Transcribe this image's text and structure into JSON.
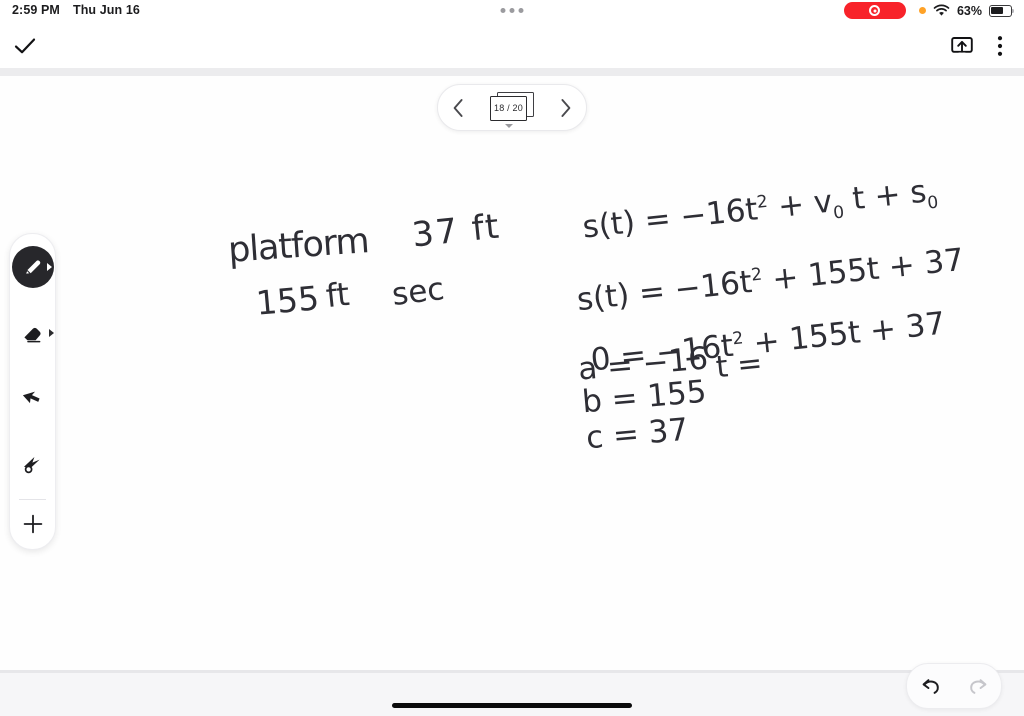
{
  "status_bar": {
    "time": "2:59 PM",
    "date": "Thu Jun 16",
    "battery_percent": "63%",
    "battery_level": 63,
    "recording_indicator": "screen-recording-active",
    "privacy_dot": "microphone-in-use",
    "wifi": "wifi-connected",
    "multitasking_handle": "three-dots"
  },
  "toolbar": {
    "done_label": "done-checkmark",
    "share_label": "share-export",
    "more_label": "more-options"
  },
  "page_navigator": {
    "prev_label": "previous-page",
    "next_label": "next-page",
    "page_indicator": "18 / 20",
    "current_page": 18,
    "total_pages": 20
  },
  "tool_palette": {
    "tools": [
      {
        "name": "pen",
        "label": "Pen",
        "selected": true,
        "has_options": true
      },
      {
        "name": "eraser",
        "label": "Eraser",
        "selected": false,
        "has_options": true
      },
      {
        "name": "selection-arrow",
        "label": "Select",
        "selected": false,
        "has_options": false
      },
      {
        "name": "laser-pointer",
        "label": "Laser",
        "selected": false,
        "has_options": false
      },
      {
        "name": "add",
        "label": "Add",
        "selected": false,
        "has_options": false
      }
    ]
  },
  "history_controls": {
    "undo_label": "Undo",
    "undo_enabled": true,
    "redo_label": "Redo",
    "redo_enabled": false
  },
  "canvas": {
    "notes_left": [
      {
        "id": "note-platform",
        "text": "platform"
      },
      {
        "id": "note-height",
        "text": "37 ft"
      },
      {
        "id": "note-velocity",
        "text": "155"
      },
      {
        "id": "note-units-ft",
        "text": "ft"
      },
      {
        "id": "note-units-sec",
        "text": "sec"
      }
    ],
    "equations": [
      {
        "id": "equation-general",
        "lhs": "s(t) =",
        "rhs_a": "−16t",
        "exp_a": "2",
        "rhs_b": "+ v",
        "sub_b": "0",
        "rhs_c": "t + s",
        "sub_c": "0"
      },
      {
        "id": "equation-substituted",
        "text": "s(t) = −16t",
        "exp": "2",
        "tail": "+ 155t + 37"
      },
      {
        "id": "equation-zero",
        "text": "0 = −16t",
        "exp": "2",
        "tail": "+ 155t + 37"
      }
    ],
    "coefficients": [
      {
        "id": "coefficient-a",
        "text": "a = −16"
      },
      {
        "id": "coefficient-b",
        "text": "b = 155"
      },
      {
        "id": "coefficient-c",
        "text": "c = 37"
      }
    ],
    "solve_for": {
      "id": "solve-for-t",
      "text": "t ="
    }
  },
  "colors": {
    "accent_record": "#f8232a",
    "privacy_dot": "#ffa227",
    "ink": "#2e2e35",
    "tool_selected_bg": "#27272b",
    "page_bg": "#fefefe",
    "app_bg": "#f6f6f8"
  }
}
